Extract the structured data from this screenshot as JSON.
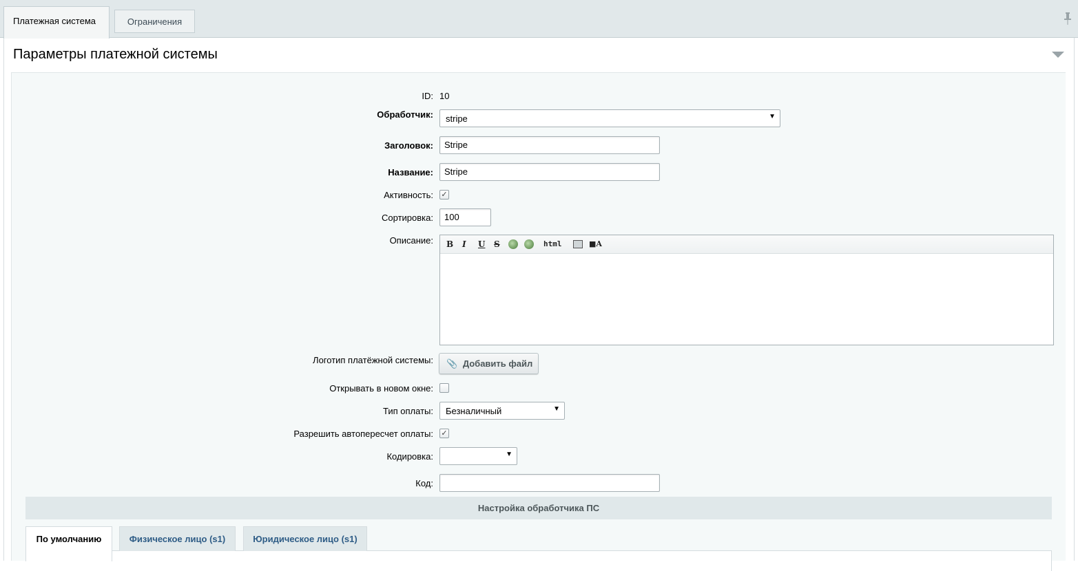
{
  "tabs": {
    "payment_system": "Платежная система",
    "restrictions": "Ограничения"
  },
  "panel": {
    "title": "Параметры платежной системы"
  },
  "form": {
    "id_label": "ID:",
    "id_value": "10",
    "handler_label": "Обработчик:",
    "handler_value": "stripe",
    "header_label": "Заголовок:",
    "header_value": "Stripe",
    "name_label": "Название:",
    "name_value": "Stripe",
    "active_label": "Активность:",
    "active_checked": true,
    "sort_label": "Сортировка:",
    "sort_value": "100",
    "description_label": "Описание:",
    "editor_html_label": "html",
    "logo_label": "Логотип платёжной системы:",
    "add_file_label": "Добавить файл",
    "new_window_label": "Открывать в новом окне:",
    "new_window_checked": false,
    "payment_type_label": "Тип оплаты:",
    "payment_type_value": "Безналичный",
    "autorecalc_label": "Разрешить автопересчет оплаты:",
    "autorecalc_checked": true,
    "encoding_label": "Кодировка:",
    "encoding_value": "",
    "code_label": "Код:",
    "code_value": ""
  },
  "handler_settings": {
    "title": "Настройка обработчика ПС",
    "tabs": [
      "По умолчанию",
      "Физическое лицо (s1)",
      "Юридическое лицо (s1)"
    ]
  }
}
